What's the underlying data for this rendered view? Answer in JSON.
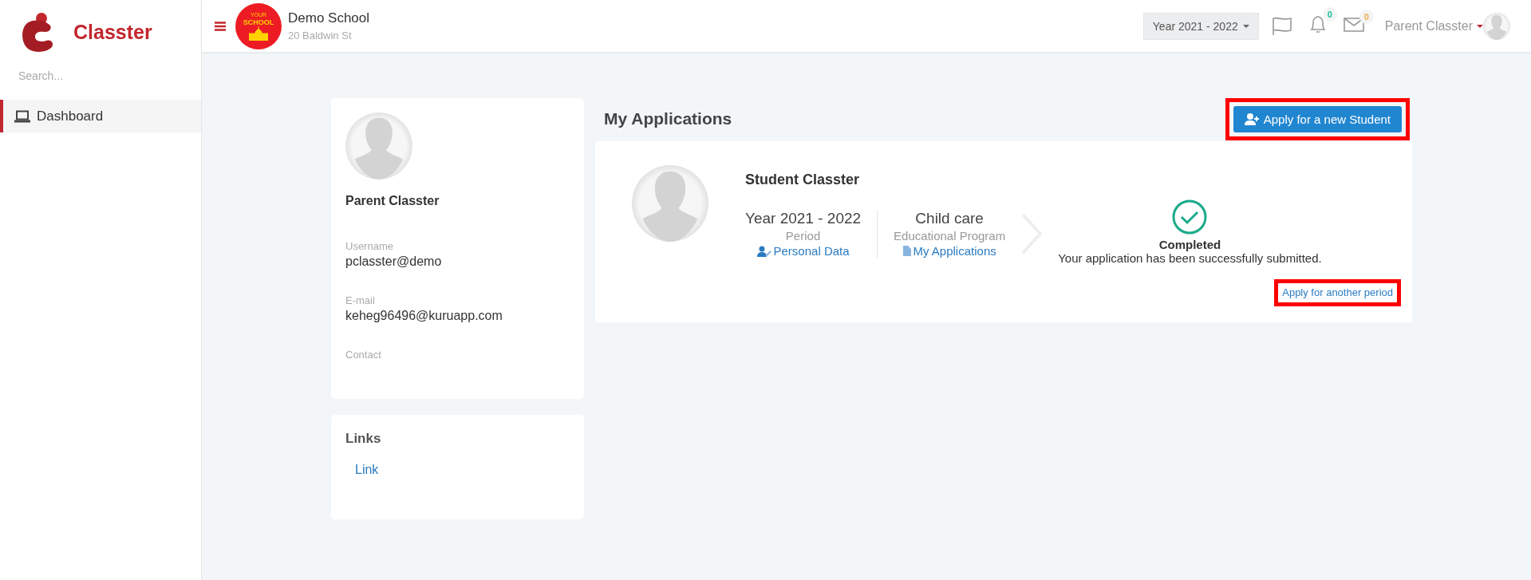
{
  "sidebar": {
    "logo_text": "Classter",
    "search": {
      "placeholder": "Search..."
    },
    "items": [
      {
        "label": "Dashboard",
        "selected": true
      }
    ]
  },
  "header": {
    "school_name": "Demo School",
    "school_address": "20 Baldwin St",
    "logo_top": "YOUR",
    "logo_main": "SCHOOL",
    "year_selector": "Year 2021 - 2022",
    "badges": [
      {
        "kind": "bell",
        "count": "0",
        "color": "#1abc9c"
      },
      {
        "kind": "envelope",
        "count": "0",
        "color": "#f0ad4e"
      }
    ],
    "user_name": "Parent Classter"
  },
  "profile": {
    "name": "Parent Classter",
    "fields": [
      {
        "label": "Username",
        "value": "pclasster@demo"
      },
      {
        "label": "E-mail",
        "value": "keheg96496@kuruapp.com"
      },
      {
        "label": "Contact"
      }
    ]
  },
  "links": {
    "title": "Links",
    "items": [
      "Link"
    ]
  },
  "applications": {
    "title": "My Applications",
    "new_button": {
      "label": "Apply for a new Student",
      "highlighted": true
    },
    "items": [
      {
        "student": "Student Classter",
        "period_value": "Year 2021 - 2022",
        "period_label": "Period",
        "period_link": "Personal Data",
        "program_value": "Child care",
        "program_label": "Educational Program",
        "program_link": "My Applications",
        "status": "Completed",
        "status_message": "Your application has been successfully submitted.",
        "another_period": {
          "label": "Apply for another period",
          "highlighted": true
        }
      }
    ]
  }
}
